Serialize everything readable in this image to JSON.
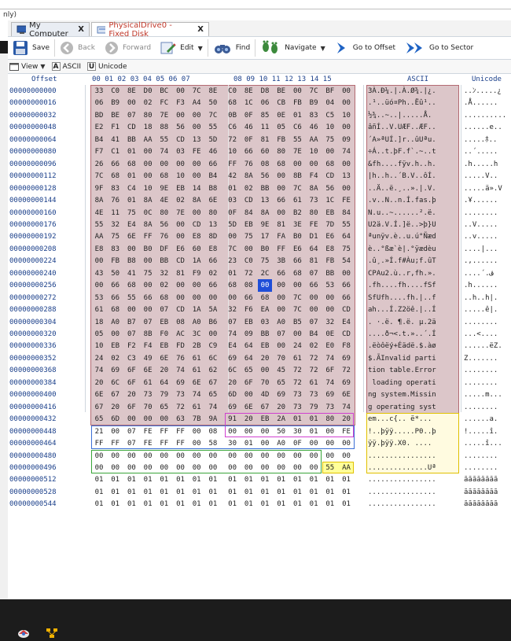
{
  "window": {
    "title_fragment": "nly)"
  },
  "tabs": [
    {
      "label": "My Computer",
      "active": false,
      "close": "X"
    },
    {
      "label": "PhysicalDrive0 - Fixed Disk",
      "active": true,
      "close": "X"
    }
  ],
  "toolbar": {
    "save": "Save",
    "back": "Back",
    "forward": "Forward",
    "edit": "Edit",
    "find": "Find",
    "navigate": "Navigate",
    "goto_offset": "Go to Offset",
    "goto_sector": "Go to Sector"
  },
  "viewbar": {
    "view": "View",
    "ascii_badge": "A",
    "ascii": "ASCII",
    "unicode_badge": "U",
    "unicode": "Unicode"
  },
  "columns": {
    "offset": "Offset",
    "bytes_a": "00 01 02 03 04 05 06 07",
    "bytes_b": "08 09 10 11 12 13 14 15",
    "ascii": "ASCII",
    "unicode": "Unicode"
  },
  "colors": {
    "mbr_fill": "#dcc6c9",
    "mbr_border": "#b46a72",
    "sig_fill": "#ffff99",
    "yellow_border": "#e0c000",
    "green_border": "#39a639",
    "blue_border": "#3b6fd6",
    "pink_border": "#d040d0",
    "cursor": "#1f4ed8",
    "offset_text": "#1a3f8a"
  },
  "cursor": {
    "row": 16,
    "col": 10
  },
  "rows": [
    {
      "offset": "00000000000",
      "bytes": [
        "33",
        "C0",
        "8E",
        "D0",
        "BC",
        "00",
        "7C",
        "8E",
        "C0",
        "8E",
        "D8",
        "BE",
        "00",
        "7C",
        "BF",
        "00"
      ],
      "ascii": "3À.Ð¼.|.À.Ø¾.|¿.",
      "unicode": "..ﾝ.....¿"
    },
    {
      "offset": "00000000016",
      "bytes": [
        "06",
        "B9",
        "00",
        "02",
        "FC",
        "F3",
        "A4",
        "50",
        "68",
        "1C",
        "06",
        "CB",
        "FB",
        "B9",
        "04",
        "00"
      ],
      "ascii": ".¹..üó¤Ph..Ëû¹..",
      "unicode": ".Å......"
    },
    {
      "offset": "00000000032",
      "bytes": [
        "BD",
        "BE",
        "07",
        "80",
        "7E",
        "00",
        "00",
        "7C",
        "0B",
        "0F",
        "85",
        "0E",
        "01",
        "83",
        "C5",
        "10"
      ],
      "ascii": "½¾..~..|.....Å.",
      "unicode": ".........."
    },
    {
      "offset": "00000000048",
      "bytes": [
        "E2",
        "F1",
        "CD",
        "18",
        "88",
        "56",
        "00",
        "55",
        "C6",
        "46",
        "11",
        "05",
        "C6",
        "46",
        "10",
        "00"
      ],
      "ascii": "âñÍ..V.UÆF..ÆF..",
      "unicode": "......e.."
    },
    {
      "offset": "00000000064",
      "bytes": [
        "B4",
        "41",
        "BB",
        "AA",
        "55",
        "CD",
        "13",
        "5D",
        "72",
        "0F",
        "81",
        "FB",
        "55",
        "AA",
        "75",
        "09"
      ],
      "ascii": "´A»ªUÍ.]r..ûUªu.",
      "unicode": ".....ﾎ.."
    },
    {
      "offset": "00000000080",
      "bytes": [
        "F7",
        "C1",
        "01",
        "00",
        "74",
        "03",
        "FE",
        "46",
        "10",
        "66",
        "60",
        "80",
        "7E",
        "10",
        "00",
        "74"
      ],
      "ascii": "÷Á..t.þF.f`.~..t",
      "unicode": "..´....."
    },
    {
      "offset": "00000000096",
      "bytes": [
        "26",
        "66",
        "68",
        "00",
        "00",
        "00",
        "00",
        "66",
        "FF",
        "76",
        "08",
        "68",
        "00",
        "00",
        "68",
        "00"
      ],
      "ascii": "&fh....fÿv.h..h.",
      "unicode": ".h.....h"
    },
    {
      "offset": "00000000112",
      "bytes": [
        "7C",
        "68",
        "01",
        "00",
        "68",
        "10",
        "00",
        "B4",
        "42",
        "8A",
        "56",
        "00",
        "8B",
        "F4",
        "CD",
        "13"
      ],
      "ascii": "|h..h..´B.V..ôÍ.",
      "unicode": ".....V.."
    },
    {
      "offset": "00000000128",
      "bytes": [
        "9F",
        "83",
        "C4",
        "10",
        "9E",
        "EB",
        "14",
        "B8",
        "01",
        "02",
        "BB",
        "00",
        "7C",
        "8A",
        "56",
        "00"
      ],
      "ascii": "..Ä..ë.¸..».|.V.",
      "unicode": ".....ä».V"
    },
    {
      "offset": "00000000144",
      "bytes": [
        "8A",
        "76",
        "01",
        "8A",
        "4E",
        "02",
        "8A",
        "6E",
        "03",
        "CD",
        "13",
        "66",
        "61",
        "73",
        "1C",
        "FE"
      ],
      "ascii": ".v..N..n.Í.fas.þ",
      "unicode": ".Ұ......"
    },
    {
      "offset": "00000000160",
      "bytes": [
        "4E",
        "11",
        "75",
        "0C",
        "80",
        "7E",
        "00",
        "80",
        "0F",
        "84",
        "8A",
        "00",
        "B2",
        "80",
        "EB",
        "84"
      ],
      "ascii": "N.u..~......².ë.",
      "unicode": "........"
    },
    {
      "offset": "00000000176",
      "bytes": [
        "55",
        "32",
        "E4",
        "8A",
        "56",
        "00",
        "CD",
        "13",
        "5D",
        "EB",
        "9E",
        "81",
        "3E",
        "FE",
        "7D",
        "55"
      ],
      "ascii": "U2ä.V.Í.]ë..>þ}U",
      "unicode": "..V....."
    },
    {
      "offset": "00000000192",
      "bytes": [
        "AA",
        "75",
        "6E",
        "FF",
        "76",
        "00",
        "E8",
        "8D",
        "00",
        "75",
        "17",
        "FA",
        "B0",
        "D1",
        "E6",
        "64"
      ],
      "ascii": "ªunÿv.è..u.ú°Ñæd",
      "unicode": "..v....."
    },
    {
      "offset": "00000000208",
      "bytes": [
        "E8",
        "83",
        "00",
        "B0",
        "DF",
        "E6",
        "60",
        "E8",
        "7C",
        "00",
        "B0",
        "FF",
        "E6",
        "64",
        "E8",
        "75"
      ],
      "ascii": "è..°ßæ`è|.°ÿædèu",
      "unicode": "....|..."
    },
    {
      "offset": "00000000224",
      "bytes": [
        "00",
        "FB",
        "B8",
        "00",
        "BB",
        "CD",
        "1A",
        "66",
        "23",
        "C0",
        "75",
        "3B",
        "66",
        "81",
        "FB",
        "54"
      ],
      "ascii": ".û¸.»Í.f#Àu;f.ûT",
      "unicode": ".,......"
    },
    {
      "offset": "00000000240",
      "bytes": [
        "43",
        "50",
        "41",
        "75",
        "32",
        "81",
        "F9",
        "02",
        "01",
        "72",
        "2C",
        "66",
        "68",
        "07",
        "BB",
        "00"
      ],
      "ascii": "CPAu2.ù..r,fh.».",
      "unicode": "....´.ڤ"
    },
    {
      "offset": "00000000256",
      "bytes": [
        "00",
        "66",
        "68",
        "00",
        "02",
        "00",
        "00",
        "66",
        "68",
        "08",
        "00",
        "00",
        "00",
        "66",
        "53",
        "66"
      ],
      "ascii": ".fh....fh....fSf",
      "unicode": ".h...... "
    },
    {
      "offset": "00000000272",
      "bytes": [
        "53",
        "66",
        "55",
        "66",
        "68",
        "00",
        "00",
        "00",
        "00",
        "66",
        "68",
        "00",
        "7C",
        "00",
        "00",
        "66"
      ],
      "ascii": "SfUfh....fh.|..f",
      "unicode": "..h..h|."
    },
    {
      "offset": "00000000288",
      "bytes": [
        "61",
        "68",
        "00",
        "00",
        "07",
        "CD",
        "1A",
        "5A",
        "32",
        "F6",
        "EA",
        "00",
        "7C",
        "00",
        "00",
        "CD"
      ],
      "ascii": "ah...Í.Z2öê.|..Í",
      "unicode": ".....ê|."
    },
    {
      "offset": "00000000304",
      "bytes": [
        "18",
        "A0",
        "B7",
        "07",
        "EB",
        "08",
        "A0",
        "B6",
        "07",
        "EB",
        "03",
        "A0",
        "B5",
        "07",
        "32",
        "E4"
      ],
      "ascii": ". ·.ë. ¶.ë. µ.2ä",
      "unicode": "........"
    },
    {
      "offset": "00000000320",
      "bytes": [
        "05",
        "00",
        "07",
        "8B",
        "F0",
        "AC",
        "3C",
        "00",
        "74",
        "09",
        "BB",
        "07",
        "00",
        "B4",
        "0E",
        "CD"
      ],
      "ascii": "....ð¬<.t.»..´.Í",
      "unicode": "...<...."
    },
    {
      "offset": "00000000336",
      "bytes": [
        "10",
        "EB",
        "F2",
        "F4",
        "EB",
        "FD",
        "2B",
        "C9",
        "E4",
        "64",
        "EB",
        "00",
        "24",
        "02",
        "E0",
        "F8"
      ],
      "ascii": ".ëòôëý+Éädë.$.àø",
      "unicode": "......ëZ."
    },
    {
      "offset": "00000000352",
      "bytes": [
        "24",
        "02",
        "C3",
        "49",
        "6E",
        "76",
        "61",
        "6C",
        "69",
        "64",
        "20",
        "70",
        "61",
        "72",
        "74",
        "69"
      ],
      "ascii": "$.ÃInvalid parti",
      "unicode": "Z......."
    },
    {
      "offset": "00000000368",
      "bytes": [
        "74",
        "69",
        "6F",
        "6E",
        "20",
        "74",
        "61",
        "62",
        "6C",
        "65",
        "00",
        "45",
        "72",
        "72",
        "6F",
        "72"
      ],
      "ascii": "tion table.Error",
      "unicode": "........"
    },
    {
      "offset": "00000000384",
      "bytes": [
        "20",
        "6C",
        "6F",
        "61",
        "64",
        "69",
        "6E",
        "67",
        "20",
        "6F",
        "70",
        "65",
        "72",
        "61",
        "74",
        "69"
      ],
      "ascii": " loading operati",
      "unicode": "........"
    },
    {
      "offset": "00000000400",
      "bytes": [
        "6E",
        "67",
        "20",
        "73",
        "79",
        "73",
        "74",
        "65",
        "6D",
        "00",
        "4D",
        "69",
        "73",
        "73",
        "69",
        "6E"
      ],
      "ascii": "ng system.Missin",
      "unicode": ".....m..."
    },
    {
      "offset": "00000000416",
      "bytes": [
        "67",
        "20",
        "6F",
        "70",
        "65",
        "72",
        "61",
        "74",
        "69",
        "6E",
        "67",
        "20",
        "73",
        "79",
        "73",
        "74"
      ],
      "ascii": "g operating syst",
      "unicode": "........"
    },
    {
      "offset": "00000000432",
      "bytes": [
        "65",
        "6D",
        "00",
        "00",
        "00",
        "63",
        "7B",
        "9A",
        "91",
        "20",
        "EB",
        "2A",
        "01",
        "01",
        "80",
        "20"
      ],
      "ascii": "em...c{.. ë*... ",
      "unicode": "......a."
    },
    {
      "offset": "00000000448",
      "bytes": [
        "21",
        "00",
        "07",
        "FE",
        "FF",
        "FF",
        "00",
        "08",
        "00",
        "00",
        "00",
        "50",
        "30",
        "01",
        "00",
        "FE"
      ],
      "ascii": "!..þÿÿ.....P0..þ",
      "unicode": "!.....î."
    },
    {
      "offset": "00000000464",
      "bytes": [
        "FF",
        "FF",
        "07",
        "FE",
        "FF",
        "FF",
        "00",
        "58",
        "30",
        "01",
        "00",
        "A0",
        "0F",
        "00",
        "00",
        "00"
      ],
      "ascii": "ÿÿ.þÿÿ.X0. ....",
      "unicode": ".....î..."
    },
    {
      "offset": "00000000480",
      "bytes": [
        "00",
        "00",
        "00",
        "00",
        "00",
        "00",
        "00",
        "00",
        "00",
        "00",
        "00",
        "00",
        "00",
        "00",
        "00",
        "00"
      ],
      "ascii": "................",
      "unicode": "........"
    },
    {
      "offset": "00000000496",
      "bytes": [
        "00",
        "00",
        "00",
        "00",
        "00",
        "00",
        "00",
        "00",
        "00",
        "00",
        "00",
        "00",
        "00",
        "00",
        "55",
        "AA"
      ],
      "ascii": "..............Uª",
      "unicode": "........"
    },
    {
      "offset": "00000000512",
      "bytes": [
        "01",
        "01",
        "01",
        "01",
        "01",
        "01",
        "01",
        "01",
        "01",
        "01",
        "01",
        "01",
        "01",
        "01",
        "01",
        "01"
      ],
      "ascii": "................",
      "unicode": "āāāāāāāā"
    },
    {
      "offset": "00000000528",
      "bytes": [
        "01",
        "01",
        "01",
        "01",
        "01",
        "01",
        "01",
        "01",
        "01",
        "01",
        "01",
        "01",
        "01",
        "01",
        "01",
        "01"
      ],
      "ascii": "................",
      "unicode": "āāāāāāāā"
    },
    {
      "offset": "00000000544",
      "bytes": [
        "01",
        "01",
        "01",
        "01",
        "01",
        "01",
        "01",
        "01",
        "01",
        "01",
        "01",
        "01",
        "01",
        "01",
        "01",
        "01"
      ],
      "ascii": "................",
      "unicode": "āāāāāāāā"
    }
  ],
  "taskbar": {
    "icons": [
      "disk-tool-icon",
      "network-tool-icon"
    ]
  }
}
